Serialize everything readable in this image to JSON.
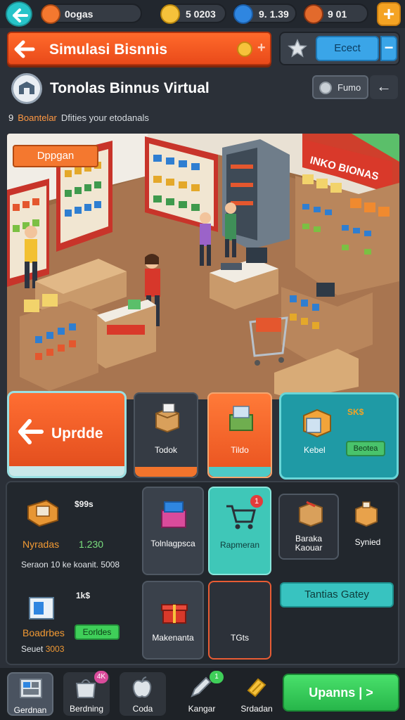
{
  "status_bar": {
    "resources": [
      {
        "icon": "orange-coin-icon",
        "text": "0ogas",
        "color": "#f4782f"
      },
      {
        "icon": "gold-coin-icon",
        "text": "5  0203",
        "color": "#f6c23b"
      },
      {
        "icon": "blue-gem-icon",
        "text": "9. 1.39",
        "color": "#2f86e0"
      },
      {
        "icon": "avatar-icon",
        "text": "9         01",
        "color": "#e26a2c"
      }
    ],
    "plus_label": "+"
  },
  "title_banner": {
    "title": "Simulasi Bisnnis",
    "plus": "+"
  },
  "fav_box": {
    "edit_label": "Ecect",
    "minus_label": "−"
  },
  "store": {
    "title": "Tonolas Binnus Virtual",
    "filter_label": "Fumo",
    "back_label": "←"
  },
  "subline": {
    "pin": "9",
    "highlight": "Boantelar",
    "text": "Dfities your etodanals"
  },
  "scene": {
    "open_tag": "Dppgan",
    "sign": "INKO BIONAS"
  },
  "upgrade_card": {
    "label": "Uprdde"
  },
  "tabs": [
    {
      "label": "Todok",
      "icon": "box-icon"
    },
    {
      "label": "Tildo",
      "icon": "produce-crate-icon"
    }
  ],
  "stock_card": {
    "price": "SK$",
    "label": "Kebel",
    "buy_label": "Beotea"
  },
  "items": [
    {
      "price": "$99s",
      "name": "Nyradas",
      "value": "1.230",
      "desc": "Seraon 10 ke koanit. 5008"
    },
    {
      "price": "1k$",
      "name": "Boadrbes",
      "badge": "Eorldes",
      "desc_prefix": "Seuet ",
      "desc_value": "3003"
    }
  ],
  "grid": [
    {
      "label": "Tolnlagpsca",
      "icon": "gift-box-icon"
    },
    {
      "label": "Rapmeran",
      "icon": "shopping-cart-icon",
      "badge": "1"
    },
    {
      "label": "Baraka\nKaouar",
      "icon": "package-icon"
    },
    {
      "label": "Synied",
      "icon": "box-tag-icon"
    },
    {
      "label": "Makenanta",
      "icon": "red-gift-icon"
    },
    {
      "label": "TGts",
      "icon": ""
    }
  ],
  "teal_button": {
    "label": "Tantias Gatey"
  },
  "bottom_nav": [
    {
      "label": "Gerdnan",
      "icon": "dashboard-icon"
    },
    {
      "label": "Berdning",
      "icon": "shopping-bag-icon",
      "badge": "4K"
    },
    {
      "label": "Coda",
      "icon": "apple-icon"
    },
    {
      "label": "Kangar",
      "icon": "pencil-icon",
      "badge": "1"
    },
    {
      "label": "Srdadan",
      "icon": "ticket-icon"
    }
  ],
  "primary_action": {
    "label": "Upanns | >"
  },
  "colors": {
    "accent_orange": "#f4782f",
    "teal": "#1f9aa5",
    "green": "#3fcf59",
    "bg": "#2b3038"
  }
}
